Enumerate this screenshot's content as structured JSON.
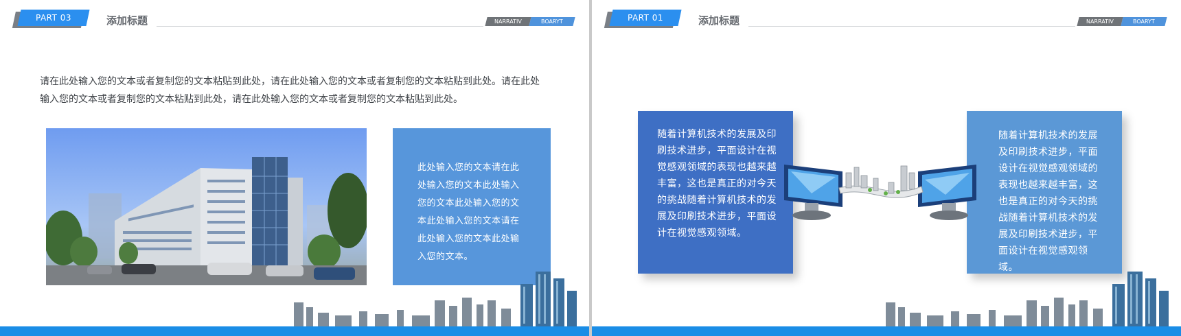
{
  "slides": [
    {
      "part_label": "PART 03",
      "header_title": "添加标题",
      "tags": [
        "NARRATIV",
        "BOARYT"
      ],
      "intro_text": "请在此处输入您的文本或者复制您的文本粘贴到此处，请在此处输入您的文本或者复制您的文本粘贴到此处。请在此处输入您的文本或者复制您的文本粘贴到此处，请在此处输入您的文本或者复制您的文本粘贴到此处。",
      "panel_text": "此处输入您的文本请在此处输入您的文本此处输入您的文本此处输入您的文本此处输入您的文本请在此处输入您的文本此处输入您的文本。"
    },
    {
      "part_label": "PART 01",
      "header_title": "添加标题",
      "tags": [
        "NARRATIV",
        "BOARYT"
      ],
      "card_left_text": "随着计算机技术的发展及印刷技术进步，平面设计在视觉感观领域的表现也越来越丰富，这也是真正的对今天的挑战随着计算机技术的发展及印刷技术进步，平面设计在视觉感观领域。",
      "card_right_text": "随着计算机技术的发展及印刷技术进步，平面设计在视觉感观领域的表现也越来越丰富，这也是真正的对今天的挑战随着计算机技术的发展及印刷技术进步，平面设计在视觉感观领域。"
    }
  ],
  "colors": {
    "accent_blue": "#2b8fef",
    "panel_blue": "#5796db",
    "card_dark_blue": "#3e6fc4",
    "card_light_blue": "#5b98d6",
    "bar_blue": "#1a8de6"
  }
}
